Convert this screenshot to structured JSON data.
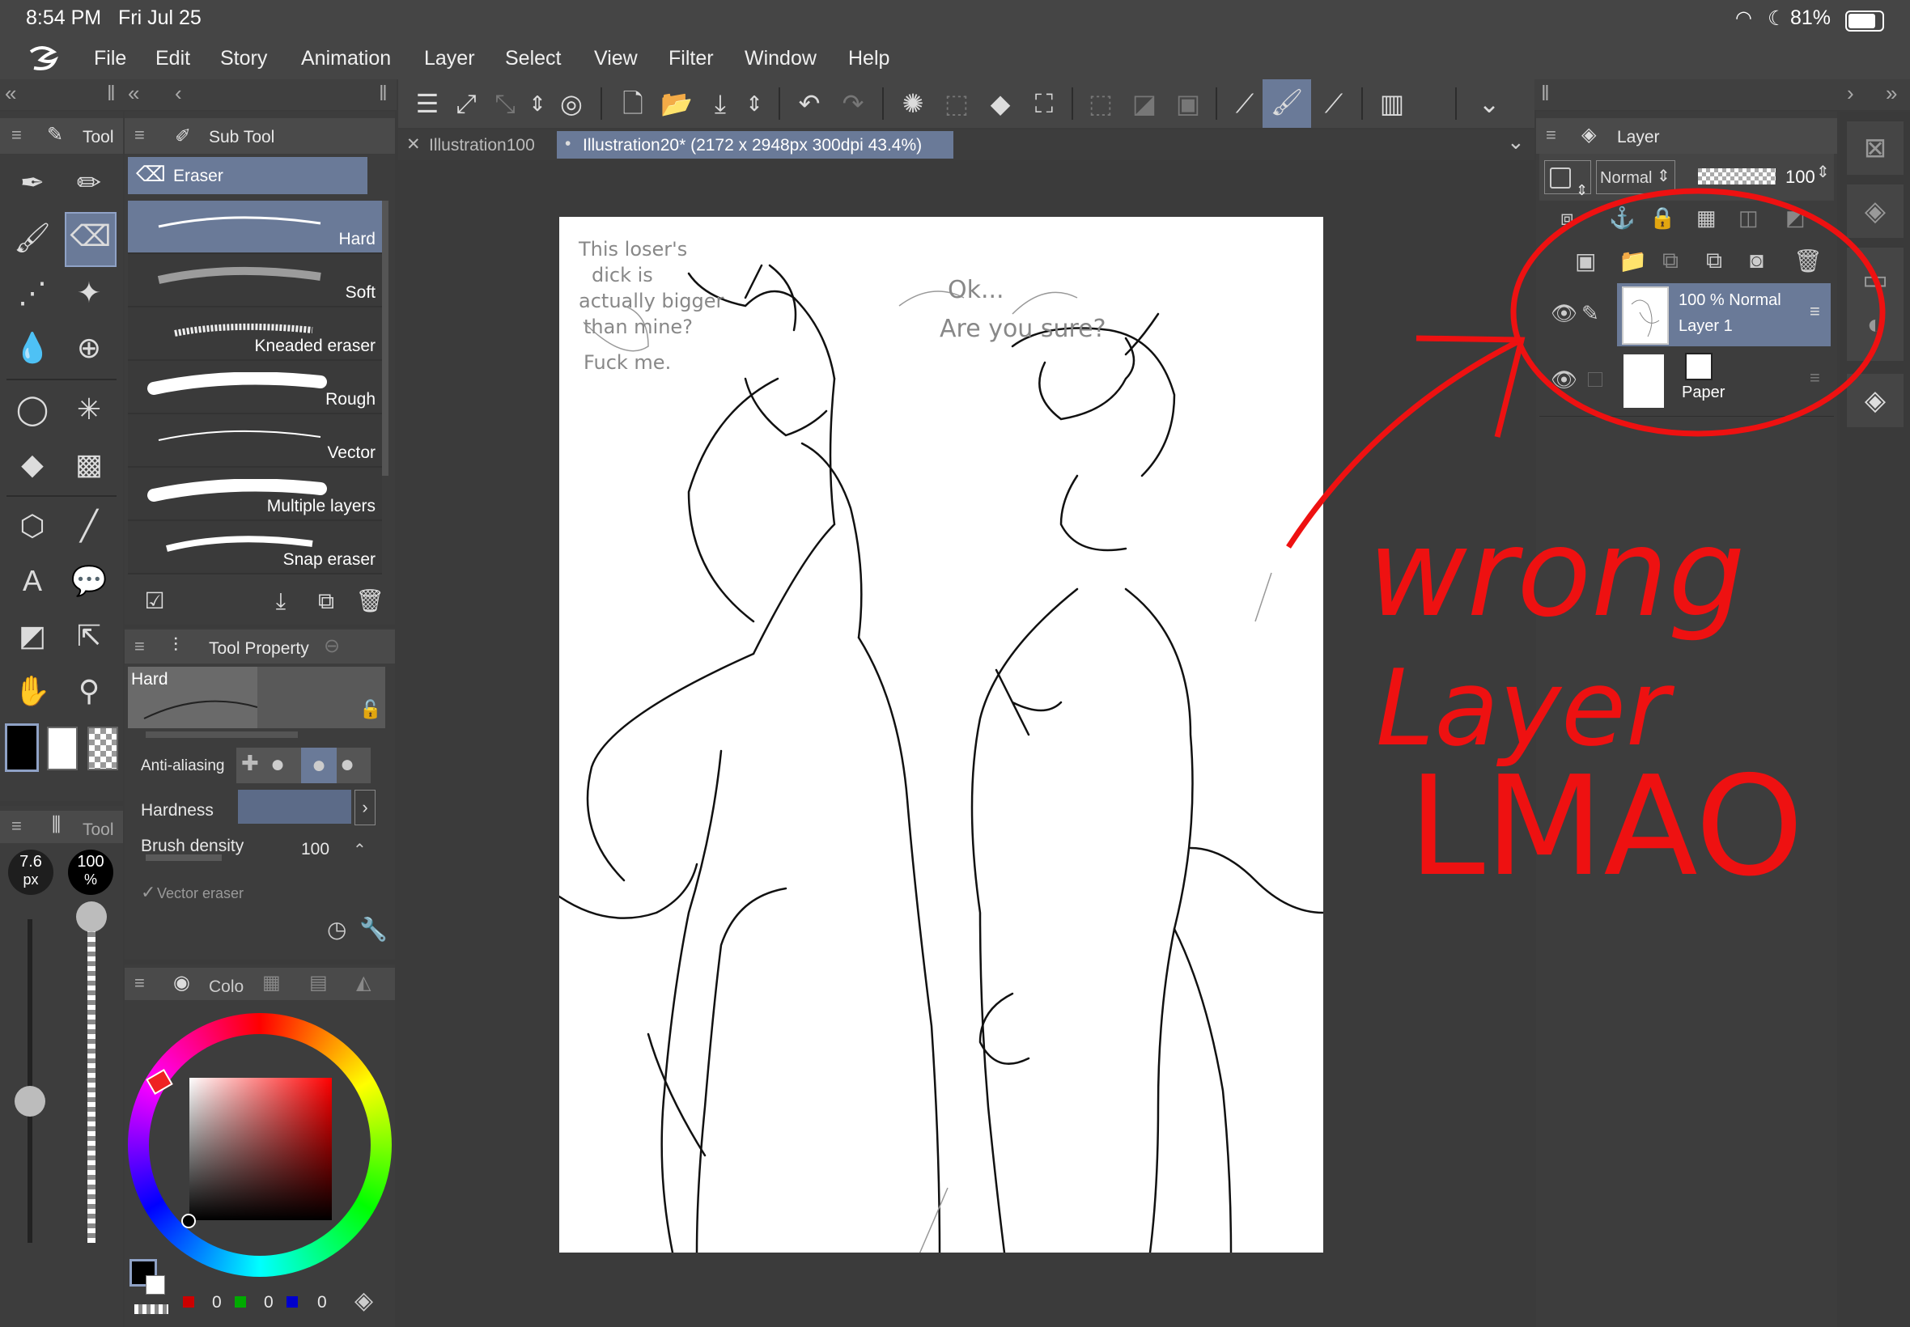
{
  "status": {
    "time": "8:54 PM",
    "date": "Fri Jul 25",
    "battery": "81%"
  },
  "menu": [
    "File",
    "Edit",
    "Story",
    "Animation",
    "Layer",
    "Select",
    "View",
    "Filter",
    "Window",
    "Help"
  ],
  "tool_panel": {
    "title": "Tool"
  },
  "sub_tool_panel": {
    "title": "Sub Tool",
    "group": "Eraser",
    "items": [
      "Hard",
      "Soft",
      "Kneaded eraser",
      "Rough",
      "Vector",
      "Multiple layers",
      "Snap eraser"
    ]
  },
  "tool_property": {
    "title": "Tool Property",
    "preview_label": "Hard",
    "anti_aliasing_label": "Anti-aliasing",
    "hardness_label": "Hardness",
    "brush_density_label": "Brush density",
    "brush_density_value": "100",
    "vector_eraser_label": "Vector eraser"
  },
  "brush_size": {
    "title": "Tool",
    "size_value": "7.6",
    "size_unit": "px",
    "opacity_value": "100",
    "opacity_unit": "%"
  },
  "color_panel": {
    "title": "Colo",
    "r": "0",
    "g": "0",
    "b": "0"
  },
  "doc_tabs": [
    "Illustration100",
    "Illustration20* (2172 x 2948px 300dpi 43.4%)"
  ],
  "canvas_notes": {
    "left_note": "This loser's dick is actually bigger than mine? Fuck me.",
    "right_note": "Ok... Are you sure?"
  },
  "layer_panel": {
    "title": "Layer",
    "blend_mode": "Normal",
    "opacity": "100",
    "layers": [
      {
        "name": "Layer 1",
        "info": "100 %  Normal"
      },
      {
        "name": "Paper"
      }
    ]
  },
  "annotation": {
    "line1": "wrong",
    "line2": "Layer",
    "line3": "LMAO",
    "color": "#ee1111"
  }
}
